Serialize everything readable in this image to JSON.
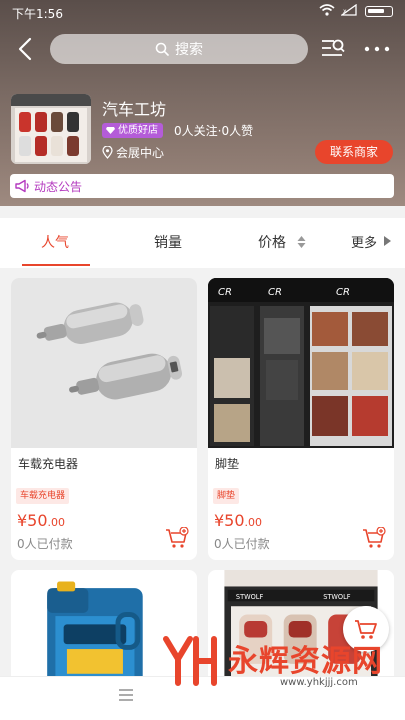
{
  "status_bar": {
    "time": "下午1:56"
  },
  "header": {
    "search_placeholder": "搜索"
  },
  "shop": {
    "name": "汽车工坊",
    "badge": "优质好店",
    "followers": "0人关注·0人赞",
    "location": "会展中心",
    "contact_button": "联系商家",
    "notice": "动态公告"
  },
  "tabs": [
    "人气",
    "销量",
    "价格",
    "更多"
  ],
  "products": [
    {
      "title": "车载充电器",
      "tag": "车载充电器",
      "price_main": "¥50",
      "price_cents": ".00",
      "paid": "0人已付款"
    },
    {
      "title": "脚垫",
      "tag": "脚垫",
      "price_main": "¥50",
      "price_cents": ".00",
      "paid": "0人已付款"
    }
  ],
  "watermark": {
    "text": "永辉资源网",
    "url": "www.yhkjjj.com"
  },
  "colors": {
    "accent": "#e8452c",
    "badge": "#b45cd8",
    "notice": "#b43abf"
  }
}
